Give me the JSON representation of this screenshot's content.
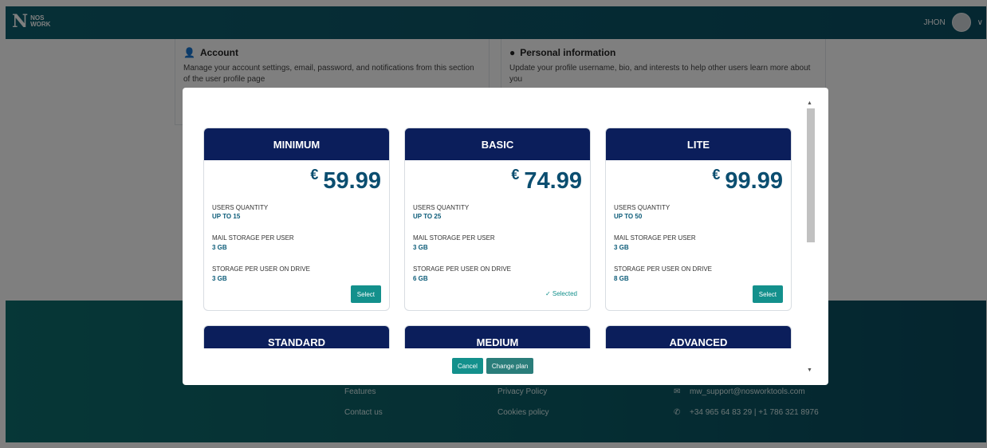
{
  "header": {
    "logo_big": "N",
    "logo_top": "NOS",
    "logo_bottom": "WORK",
    "username": "JHON",
    "chevron": "∨"
  },
  "background": {
    "account": {
      "title": "Account",
      "desc": "Manage your account settings, email, password, and notifications from this section of the user profile page"
    },
    "personal": {
      "title": "Personal information",
      "desc": "Update your profile username, bio, and interests to help other users learn more about you"
    }
  },
  "footer": {
    "features": "Features",
    "contact": "Contact us",
    "privacy": "Privacy Policy",
    "cookies": "Cookies policy",
    "email": "mw_support@nosworktools.com",
    "phone": "+34 965 64 83 29 | +1 786 321 8976"
  },
  "plans_row1": [
    {
      "name": "MINIMUM",
      "currency": "€",
      "price": "59.99",
      "users_label": "USERS QUANTITY",
      "users_value": "UP TO 15",
      "mail_label": "MAIL STORAGE PER USER",
      "mail_value": "3 GB",
      "drive_label": "STORAGE PER USER ON DRIVE",
      "drive_value": "3 GB",
      "action": "Select"
    },
    {
      "name": "BASIC",
      "currency": "€",
      "price": "74.99",
      "users_label": "USERS QUANTITY",
      "users_value": "UP TO 25",
      "mail_label": "MAIL STORAGE PER USER",
      "mail_value": "3 GB",
      "drive_label": "STORAGE PER USER ON DRIVE",
      "drive_value": "6 GB",
      "action": "✓  Selected"
    },
    {
      "name": "LITE",
      "currency": "€",
      "price": "99.99",
      "users_label": "USERS QUANTITY",
      "users_value": "UP TO 50",
      "mail_label": "MAIL STORAGE PER USER",
      "mail_value": "3 GB",
      "drive_label": "STORAGE PER USER ON DRIVE",
      "drive_value": "8 GB",
      "action": "Select"
    }
  ],
  "plans_row2": [
    "STANDARD",
    "MEDIUM",
    "ADVANCED"
  ],
  "modal_buttons": {
    "cancel": "Cancel",
    "change": "Change plan"
  },
  "scroll": {
    "up": "▲",
    "down": "▼"
  }
}
